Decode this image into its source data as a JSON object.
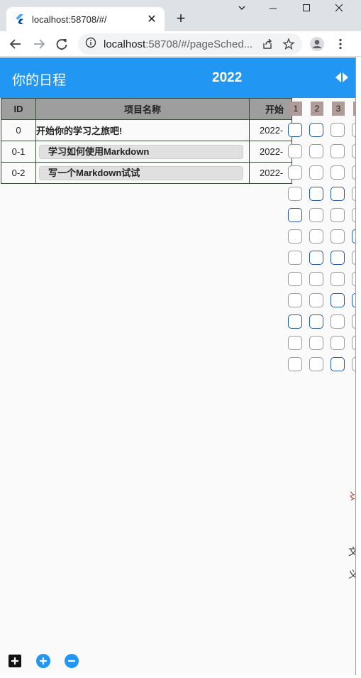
{
  "browser": {
    "tab_title": "localhost:58708/#/",
    "url_host": "localhost",
    "url_rest": ":58708/#/pageSched...",
    "colors": {
      "tabbar": "#dee1e6",
      "omnibox": "#f1f3f4"
    }
  },
  "appbar": {
    "title": "你的日程",
    "year": "2022",
    "color": "#2196f3"
  },
  "table": {
    "headers": {
      "id": "ID",
      "name": "项目名称",
      "start": "开始"
    },
    "rows": [
      {
        "id": "0",
        "name": "开始你的学习之旅吧!",
        "start": "2022-",
        "level": 0
      },
      {
        "id": "0-1",
        "name": "学习如何使用Markdown",
        "start": "2022-",
        "level": 1
      },
      {
        "id": "0-2",
        "name": "写一个Markdown试试",
        "start": "2022-",
        "level": 1
      }
    ]
  },
  "grid": {
    "day_headers": [
      "1",
      "2",
      "3",
      ""
    ],
    "rows": [
      [
        "blue",
        "blue",
        "grey",
        "grey"
      ],
      [
        "grey",
        "grey",
        "grey",
        "grey"
      ],
      [
        "grey",
        "grey",
        "grey",
        "grey"
      ],
      [
        "grey",
        "blue",
        "blue",
        "grey"
      ],
      [
        "blue",
        "grey",
        "grey",
        "grey"
      ],
      [
        "grey",
        "grey",
        "grey",
        "blue"
      ],
      [
        "grey",
        "blue",
        "blue",
        "grey"
      ],
      [
        "grey",
        "grey",
        "grey",
        "grey"
      ],
      [
        "grey",
        "grey",
        "blue",
        "blue"
      ],
      [
        "blue",
        "blue",
        "grey",
        "grey"
      ],
      [
        "grey",
        "grey",
        "grey",
        "grey"
      ],
      [
        "grey",
        "grey",
        "blue",
        "grey"
      ]
    ]
  },
  "fabs": [
    "add-box-icon",
    "add-circle-icon",
    "remove-circle-icon"
  ]
}
